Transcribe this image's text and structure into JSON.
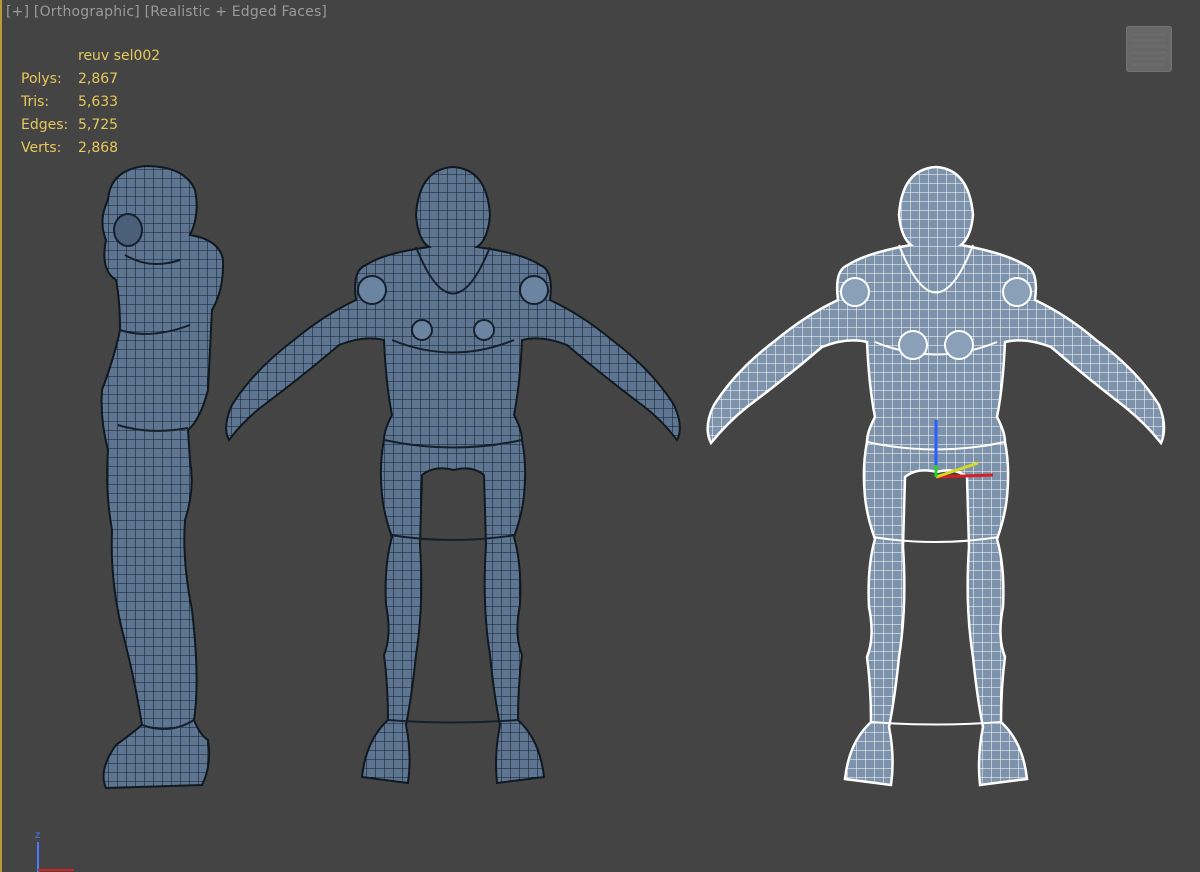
{
  "viewport": {
    "label_plus": "[+]",
    "label_view": "[Orthographic]",
    "label_shading": "[Realistic + Edged Faces]",
    "label_sep": " "
  },
  "stats": {
    "selection_name": "reuv sel002",
    "rows": [
      {
        "label": "Polys:",
        "value": "2,867"
      },
      {
        "label": "Tris:",
        "value": "5,633"
      },
      {
        "label": "Edges:",
        "value": "5,725"
      },
      {
        "label": "Verts:",
        "value": "2,868"
      }
    ]
  },
  "axis": {
    "z_label": "z"
  },
  "colors": {
    "viewport_bg": "#444444",
    "stats_text": "#e7c85a",
    "mesh_fill": "#5d7590",
    "mesh_edges": "#15202c",
    "wire_fill": "#7d93ab",
    "wire_edges": "#ffffff",
    "active_border": "#b89a3a"
  }
}
